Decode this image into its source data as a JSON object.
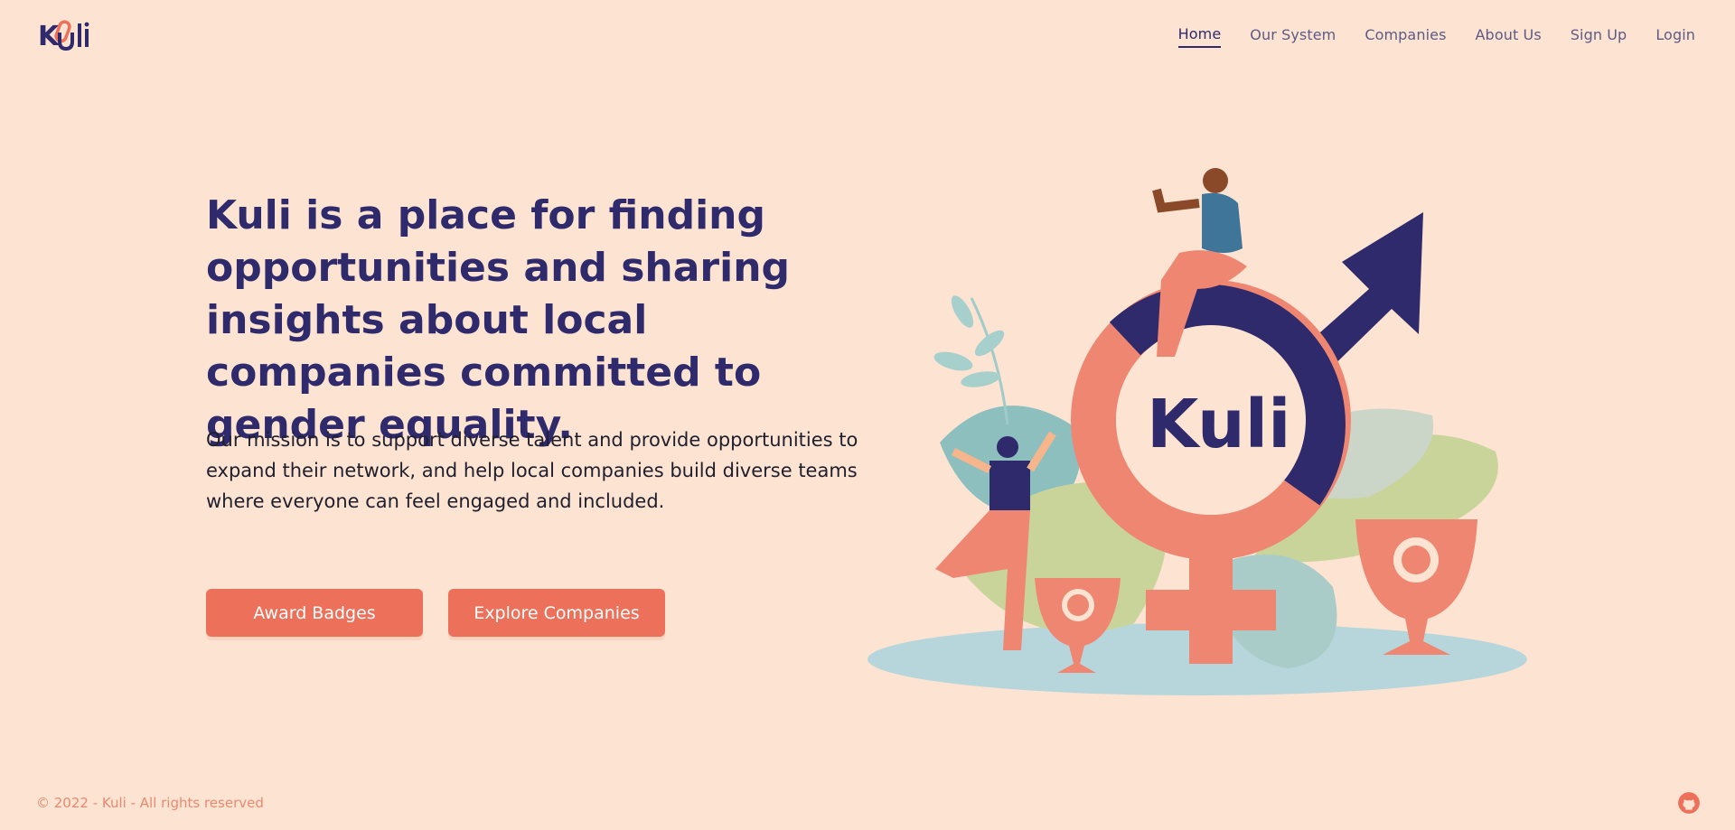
{
  "brand": {
    "name": "Kuli",
    "colors": {
      "background": "#fde3d1",
      "primary": "#2e2a6b",
      "accent": "#ec705a"
    }
  },
  "nav": {
    "items": [
      {
        "label": "Home",
        "active": true
      },
      {
        "label": "Our System",
        "active": false
      },
      {
        "label": "Companies",
        "active": false
      },
      {
        "label": "About Us",
        "active": false
      },
      {
        "label": "Sign Up",
        "active": false
      },
      {
        "label": "Login",
        "active": false
      }
    ]
  },
  "hero": {
    "title": "Kuli is a place for finding opportunities and sharing insights about local companies committed to gender equality.",
    "mission": "Our mission is to support diverse talent and provide opportunities to expand their network, and help local companies build diverse teams where everyone can feel engaged and included.",
    "buttons": {
      "award": "Award Badges",
      "explore": "Explore Companies"
    }
  },
  "illustration": {
    "logo_text": "Kuli"
  },
  "footer": {
    "copyright": "© 2022 - Kuli - All rights reserved",
    "icon": "github-icon"
  }
}
